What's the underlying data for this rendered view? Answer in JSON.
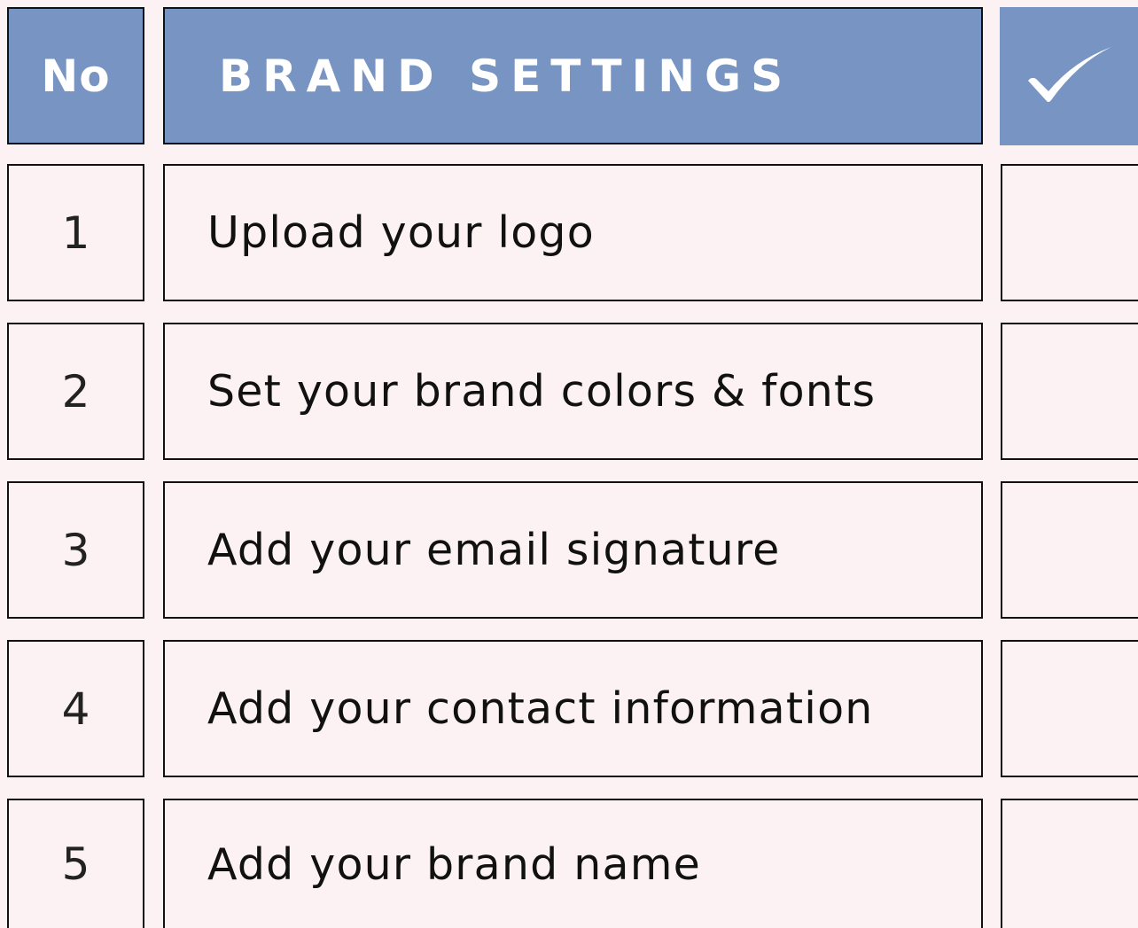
{
  "header": {
    "number_label": "No",
    "title": "BRAND SETTINGS",
    "check_icon": "checkmark-icon"
  },
  "colors": {
    "header_fill": "#7894c3",
    "page_background": "#fcf2f4",
    "border": "#111111"
  },
  "rows": [
    {
      "number": "1",
      "task": "Upload your logo",
      "checked": false
    },
    {
      "number": "2",
      "task": "Set your brand colors & fonts",
      "checked": false
    },
    {
      "number": "3",
      "task": "Add your email signature",
      "checked": false
    },
    {
      "number": "4",
      "task": "Add your contact information",
      "checked": false
    },
    {
      "number": "5",
      "task": "Add your brand name",
      "checked": false
    }
  ]
}
